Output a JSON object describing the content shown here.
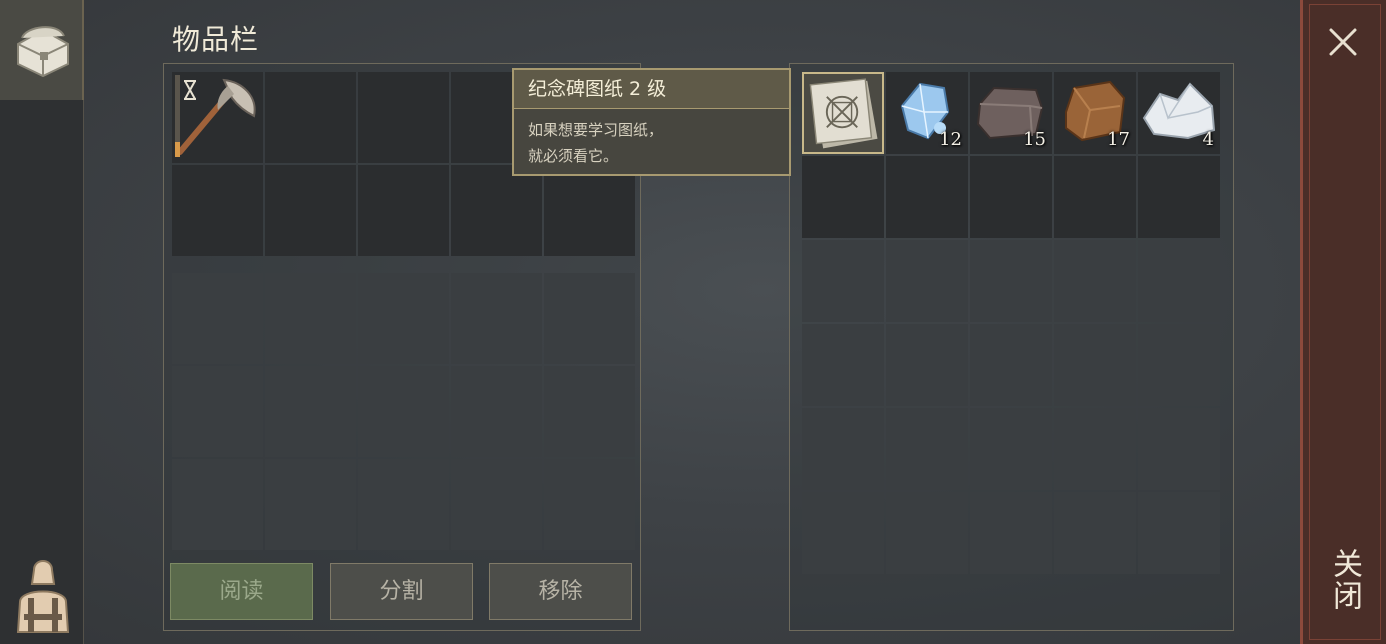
{
  "title": "物品栏",
  "tooltip": {
    "name": "纪念碑图纸 2 级",
    "desc_line1": "如果想要学习图纸，",
    "desc_line2": "就必须看它。"
  },
  "buttons": {
    "read": "阅读",
    "split": "分割",
    "remove": "移除"
  },
  "close": {
    "label": "关闭",
    "icon": "close-icon"
  },
  "sidebar": {
    "icons": [
      "chest-icon",
      "character-icon"
    ]
  },
  "equipment": {
    "slot_0": {
      "item": "axe-icon",
      "status_icon": "hourglass-icon"
    }
  },
  "storage": {
    "items": [
      {
        "name": "blueprint-icon",
        "count": ""
      },
      {
        "name": "crystal-icon",
        "count": "12"
      },
      {
        "name": "stone-icon",
        "count": "15"
      },
      {
        "name": "clay-icon",
        "count": "17"
      },
      {
        "name": "salt-icon",
        "count": "4"
      }
    ]
  },
  "colors": {
    "accent": "#a89a70",
    "read_button": "#5a6a4c",
    "close_strip": "#4a2e28"
  }
}
